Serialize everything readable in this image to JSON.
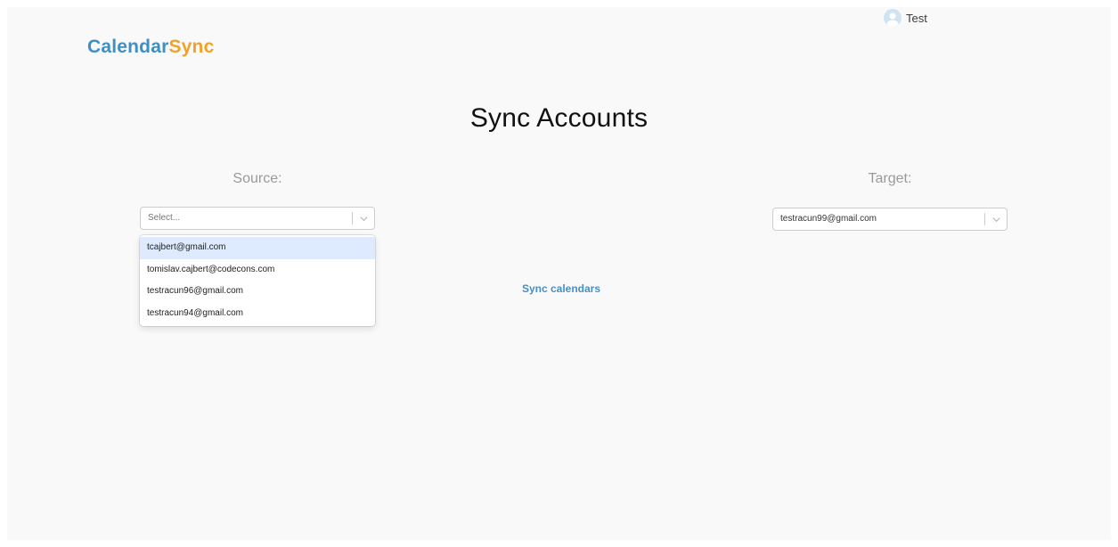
{
  "header": {
    "user_name": "Test",
    "avatar_icon": "user-avatar-icon"
  },
  "logo": {
    "part1": "Calendar",
    "part2": "Sync",
    "part1_color": "#3f8fc4",
    "part2_color": "#f0a32a"
  },
  "main": {
    "title": "Sync Accounts",
    "source": {
      "label": "Source:",
      "placeholder": "Select...",
      "options": [
        "tcajbert@gmail.com",
        "tomislav.cajbert@codecons.com",
        "testracun96@gmail.com",
        "testracun94@gmail.com"
      ],
      "focused_option": "tcajbert@gmail.com"
    },
    "target": {
      "label": "Target:",
      "value": "testracun99@gmail.com"
    },
    "sync_button": "Sync calendars"
  },
  "colors": {
    "accent": "#4b8ec2",
    "focused_option_bg": "#deebff",
    "background": "#f9f9f9"
  }
}
